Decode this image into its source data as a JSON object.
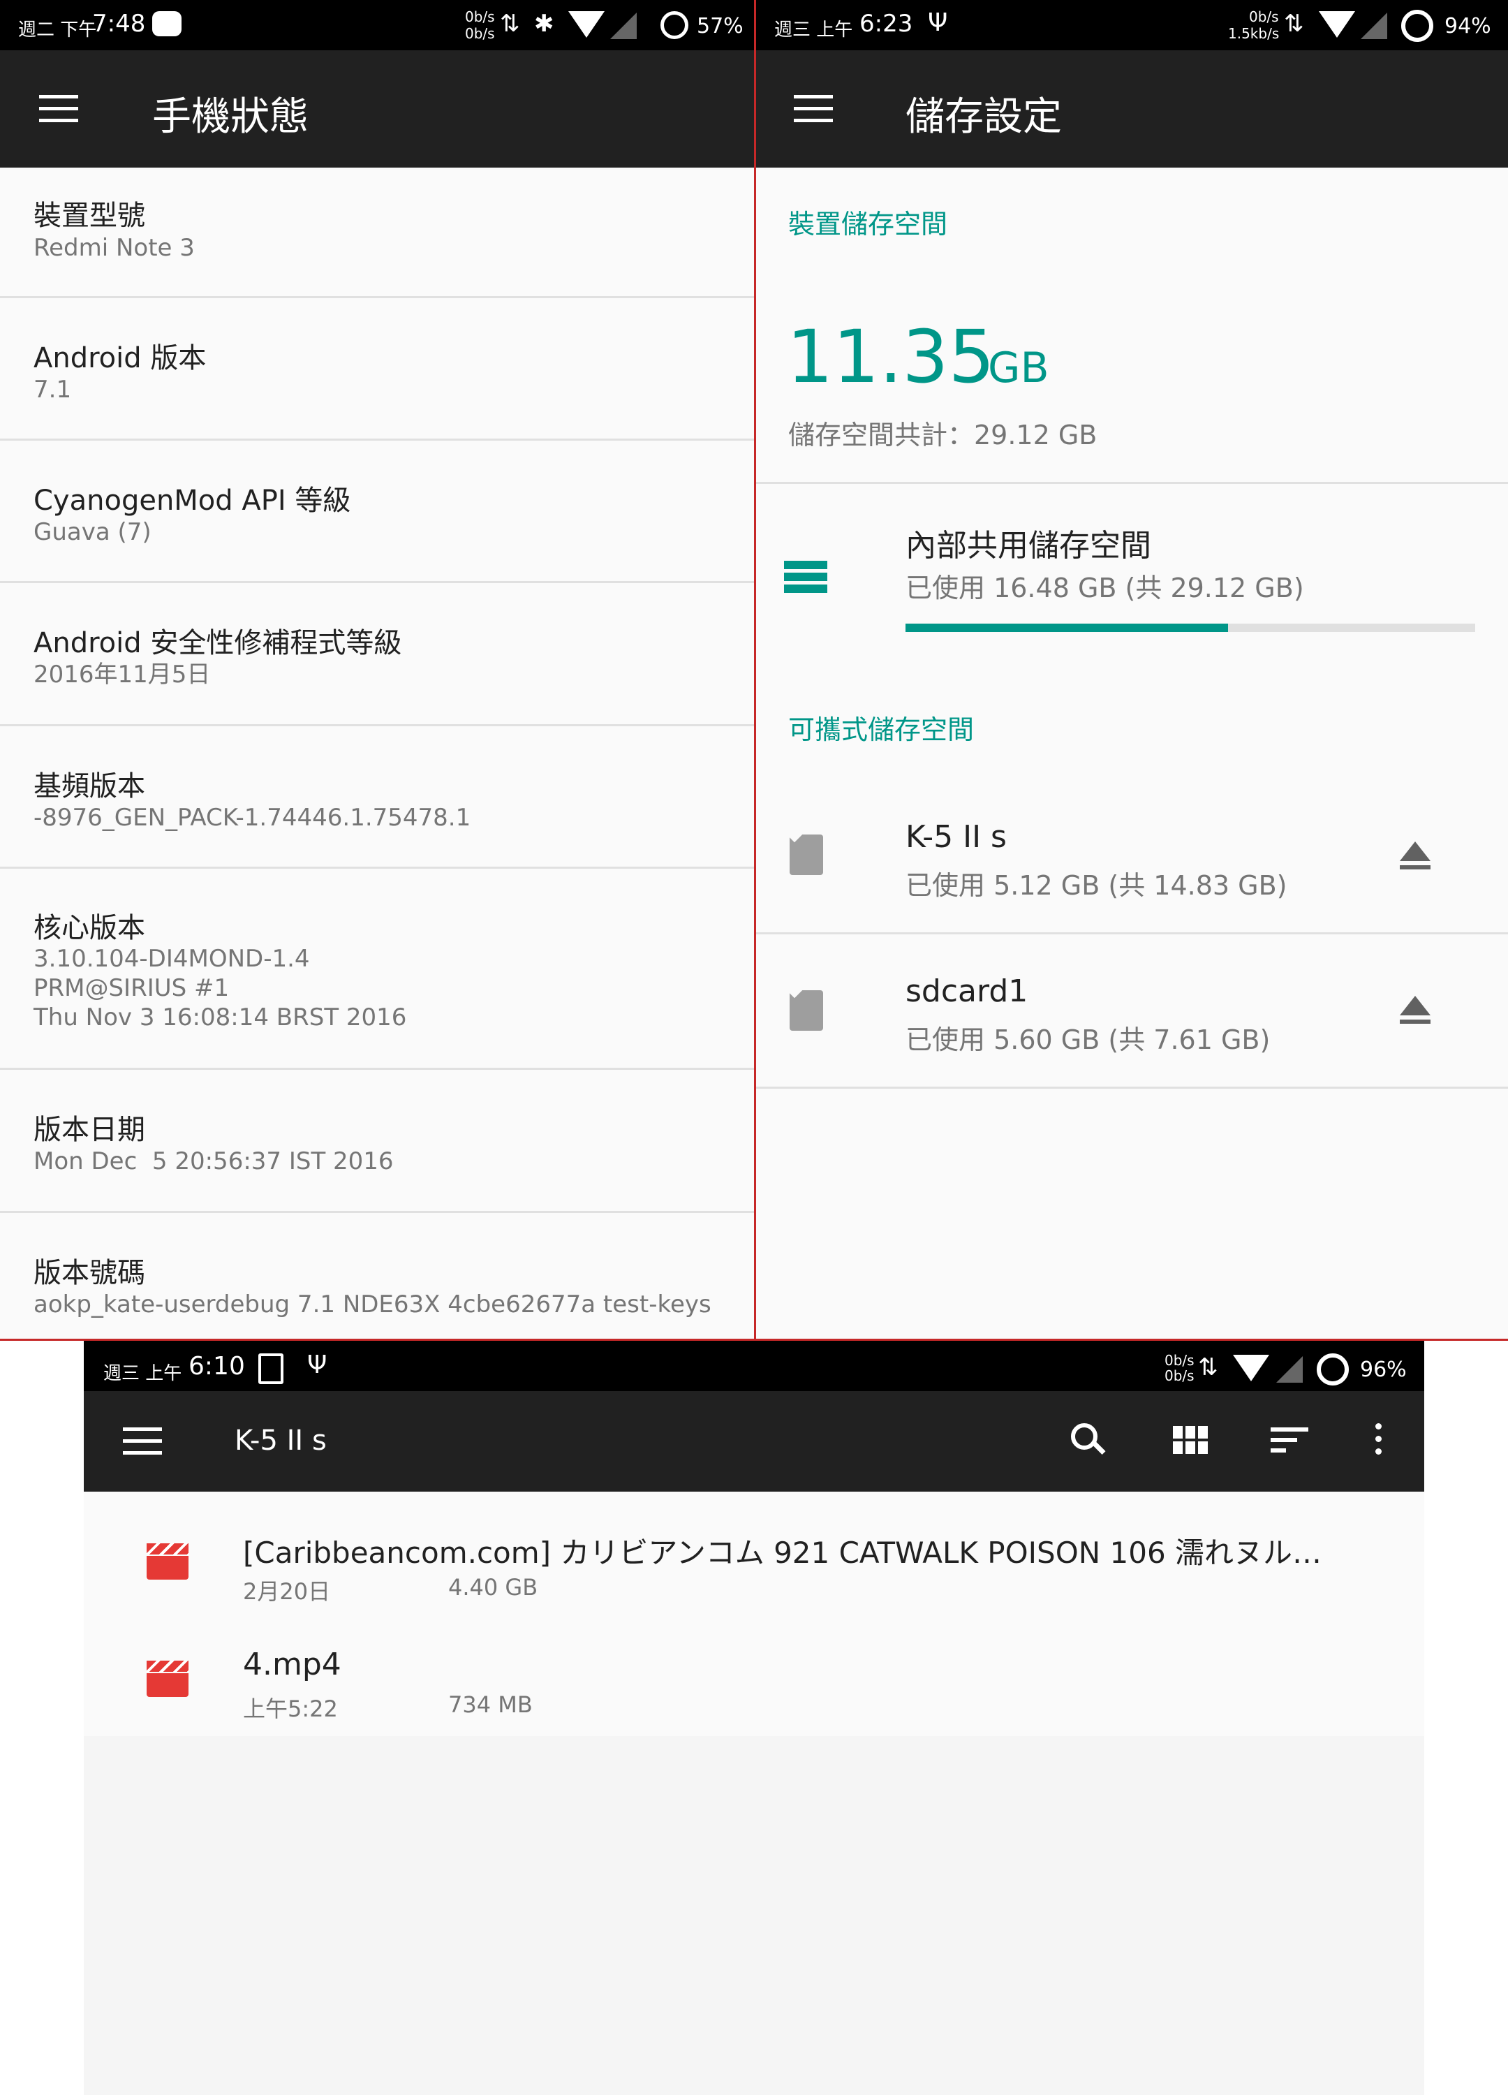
{
  "left": {
    "status": {
      "time_prefix": "週二 下午",
      "time": "7:48",
      "net_up": "0b/s",
      "net_down": "0b/s",
      "battery": "57%"
    },
    "toolbar": {
      "title": "手機狀態"
    },
    "items": [
      {
        "title": "裝置型號",
        "sub": "Redmi Note 3"
      },
      {
        "title": "Android 版本",
        "sub": "7.1"
      },
      {
        "title": "CyanogenMod API 等級",
        "sub": "Guava (7)"
      },
      {
        "title": "Android 安全性修補程式等級",
        "sub": "2016年11月5日"
      },
      {
        "title": "基頻版本",
        "sub": "-8976_GEN_PACK-1.74446.1.75478.1"
      },
      {
        "title": "核心版本",
        "sub": "3.10.104-DI4MOND-1.4\nPRM@SIRIUS #1\nThu Nov 3 16:08:14 BRST 2016"
      },
      {
        "title": "版本日期",
        "sub": "Mon Dec  5 20:56:37 IST 2016"
      },
      {
        "title": "版本號碼",
        "sub": "aokp_kate-userdebug 7.1 NDE63X 4cbe62677a test-keys"
      }
    ]
  },
  "right": {
    "status": {
      "time_prefix": "週三 上午",
      "time": "6:23",
      "net_up": "0b/s",
      "net_down": "1.5kb/s",
      "battery": "94%"
    },
    "toolbar": {
      "title": "儲存設定"
    },
    "device_header": "裝置儲存空間",
    "used_value": "11.35",
    "used_unit": "GB",
    "total_text": "儲存空間共計：29.12 GB",
    "internal": {
      "title": "內部共用儲存空間",
      "sub": "已使用 16.48 GB (共 29.12 GB)",
      "used_fraction": 0.566
    },
    "portable_header": "可攜式儲存空間",
    "portable": [
      {
        "title": "K-5 II s",
        "sub": "已使用 5.12 GB (共 14.83 GB)"
      },
      {
        "title": "sdcard1",
        "sub": "已使用 5.60 GB (共 7.61 GB)"
      }
    ]
  },
  "bottom": {
    "status": {
      "time_prefix": "週三 上午",
      "time": "6:10",
      "net_up": "0b/s",
      "net_down": "0b/s",
      "battery": "96%"
    },
    "toolbar": {
      "title": "K-5 II s"
    },
    "files": [
      {
        "name": "[Caribbeancom.com] カリビアンコム 921 CATWALK POISON 106 濡れヌル…",
        "date": "2月20日",
        "size": "4.40 GB"
      },
      {
        "name": "4.mp4",
        "date": "上午5:22",
        "size": "734 MB"
      }
    ]
  },
  "colors": {
    "accent": "#009688",
    "toolbar": "#212121",
    "video": "#e53935"
  }
}
